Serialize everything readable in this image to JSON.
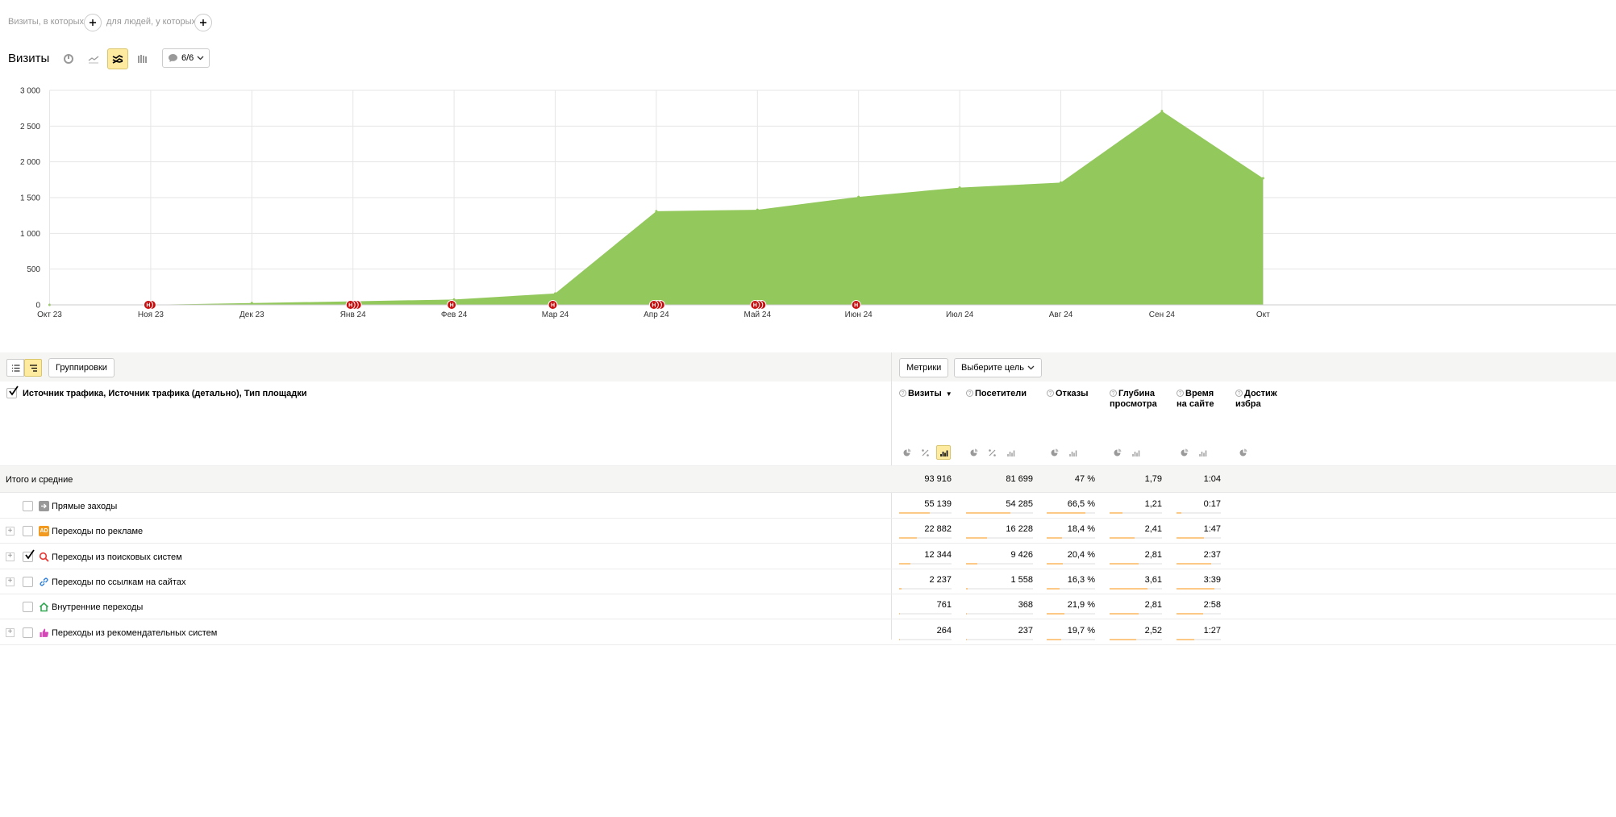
{
  "segment": {
    "visits_label": "Визиты, в которых",
    "people_label": "для людей, у которых"
  },
  "chart_header": {
    "title": "Визиты",
    "notes_count": "6/6"
  },
  "chart_data": {
    "type": "area",
    "x": [
      "Окт 23",
      "Ноя 23",
      "Дек 23",
      "Янв 24",
      "Фев 24",
      "Мар 24",
      "Апр 24",
      "Май 24",
      "Июн 24",
      "Июл 24",
      "Авг 24",
      "Сен 24",
      "Окт 24"
    ],
    "x_tick_labels": [
      "Окт 23",
      "Ноя 23",
      "Дек 23",
      "Янв 24",
      "Фев 24",
      "Мар 24",
      "Апр 24",
      "Май 24",
      "Июн 24",
      "Июл 24",
      "Авг 24",
      "Сен 24",
      "Окт"
    ],
    "series": [
      {
        "values": [
          0,
          2,
          25,
          50,
          75,
          160,
          1310,
          1330,
          1510,
          1640,
          1710,
          2710,
          1770
        ]
      }
    ],
    "y_ticks": [
      "0",
      "500",
      "1 000",
      "1 500",
      "2 000",
      "2 500",
      "3 000"
    ],
    "ylim": [
      0,
      3000
    ],
    "grid": true,
    "annotations": [
      {
        "x": "Ноя 23",
        "count": 2
      },
      {
        "x": "Янв 24",
        "count": 3
      },
      {
        "x": "Фев 24",
        "count": 1
      },
      {
        "x": "Мар 24",
        "count": 1
      },
      {
        "x": "Апр 24",
        "count": 3
      },
      {
        "x": "Май 24",
        "count": 3
      },
      {
        "x": "Июн 24",
        "count": 1
      }
    ],
    "annotation_letter": "Н",
    "color": "#93c85d"
  },
  "report": {
    "groupings_button": "Группировки",
    "metrics_button": "Метрики",
    "goal_button": "Выберите цель",
    "dimension_title": "Источник трафика, Источник трафика (детально), Тип площадки",
    "columns": [
      {
        "line1": "Визиты",
        "line2": "",
        "sorted": "▼"
      },
      {
        "line1": "Посетители",
        "line2": ""
      },
      {
        "line1": "Отказы",
        "line2": ""
      },
      {
        "line1": "Глубина",
        "line2": "просмотра"
      },
      {
        "line1": "Время",
        "line2": "на сайте"
      },
      {
        "line1": "Достиж",
        "line2": "избра"
      }
    ],
    "totals_label": "Итого и средние",
    "totals": [
      "93 916",
      "81 699",
      "47 %",
      "1,79",
      "1:04"
    ],
    "rows": [
      {
        "label": "Прямые заходы",
        "icon": "direct-arrow-icon",
        "expandable": false,
        "checked": false,
        "values": [
          "55 139",
          "54 285",
          "66,5 %",
          "1,21",
          "0:17"
        ],
        "fills": [
          0.59,
          0.66,
          0.8,
          0.25,
          0.1
        ]
      },
      {
        "label": "Переходы по рекламе",
        "icon": "ad-badge-icon",
        "expandable": true,
        "checked": false,
        "values": [
          "22 882",
          "16 228",
          "18,4 %",
          "2,41",
          "1:47"
        ],
        "fills": [
          0.34,
          0.31,
          0.31,
          0.48,
          0.62
        ]
      },
      {
        "label": "Переходы из поисковых систем",
        "icon": "search-magnifier-icon",
        "expandable": true,
        "checked": true,
        "values": [
          "12 344",
          "9 426",
          "20,4 %",
          "2,81",
          "2:37"
        ],
        "fills": [
          0.21,
          0.17,
          0.33,
          0.56,
          0.78
        ]
      },
      {
        "label": "Переходы по ссылкам на сайтах",
        "icon": "link-chain-icon",
        "expandable": true,
        "checked": false,
        "values": [
          "2 237",
          "1 558",
          "16,3 %",
          "3,61",
          "3:39"
        ],
        "fills": [
          0.04,
          0.03,
          0.26,
          0.72,
          0.85
        ]
      },
      {
        "label": "Внутренние переходы",
        "icon": "home-icon",
        "expandable": false,
        "checked": false,
        "values": [
          "761",
          "368",
          "21,9 %",
          "2,81",
          "2:58"
        ],
        "fills": [
          0.02,
          0.01,
          0.36,
          0.56,
          0.6
        ]
      },
      {
        "label": "Переходы из рекомендательных систем",
        "icon": "thumbs-up-icon",
        "expandable": true,
        "checked": false,
        "values": [
          "264",
          "237",
          "19,7 %",
          "2,52",
          "1:27"
        ],
        "fills": [
          0.01,
          0.01,
          0.3,
          0.5,
          0.4
        ]
      }
    ]
  }
}
